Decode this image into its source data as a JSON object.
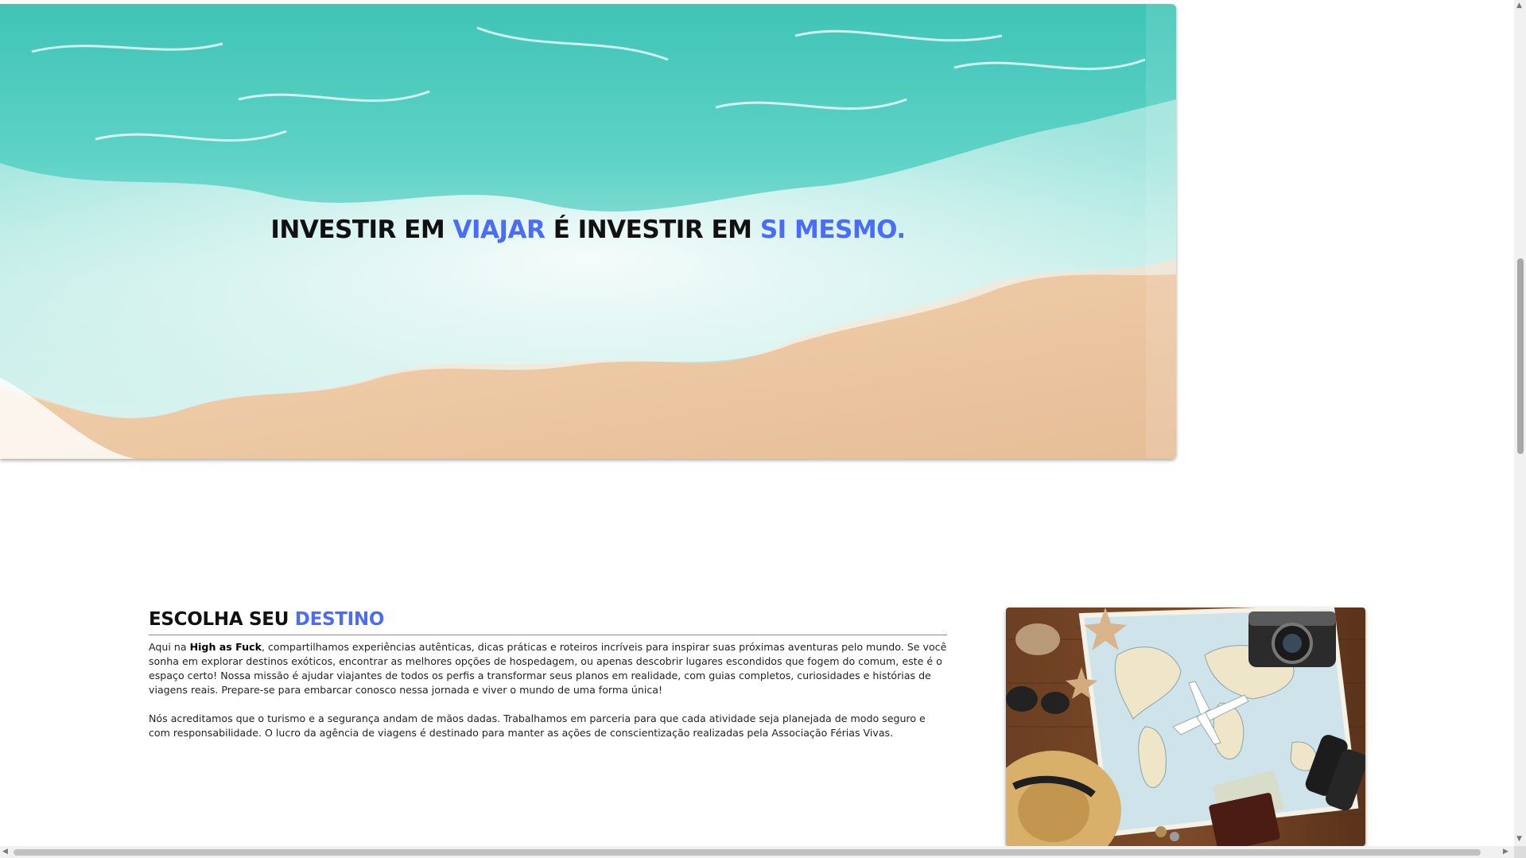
{
  "hero": {
    "headline_part1": "INVESTIR EM ",
    "headline_accent1": "VIAJAR",
    "headline_part2": " É INVESTIR EM ",
    "headline_accent2": "SI MESMO.",
    "image_label": "beach-waves-image"
  },
  "destino": {
    "title_part1": "ESCOLHA SEU ",
    "title_accent": "DESTINO",
    "p1_before": "Aqui na ",
    "p1_brand": "High as Fuck",
    "p1_after": ", compartilhamos experiências autênticas, dicas práticas e roteiros incríveis para inspirar suas próximas aventuras pelo mundo. Se você sonha em explorar destinos exóticos, encontrar as melhores opções de hospedagem, ou apenas descobrir lugares escondidos que fogem do comum, este é o espaço certo! Nossa missão é ajudar viajantes de todos os perfis a transformar seus planos em realidade, com guias completos, curiosidades e histórias de viagens reais. Prepare-se para embarcar conosco nessa jornada e viver o mundo de uma forma única!",
    "p2": "Nós acreditamos que o turismo e a segurança andam de mãos dadas. Trabalhamos em parceria para que cada atividade seja planejada de modo seguro e com responsabilidade. O lucro da agência de viagens é destinado para manter as ações de conscientização realizadas pela Associação Férias Vivas.",
    "photo_label": "travel-flatlay-image"
  },
  "colors": {
    "accent": "#4a6cf7",
    "text": "#111111"
  }
}
